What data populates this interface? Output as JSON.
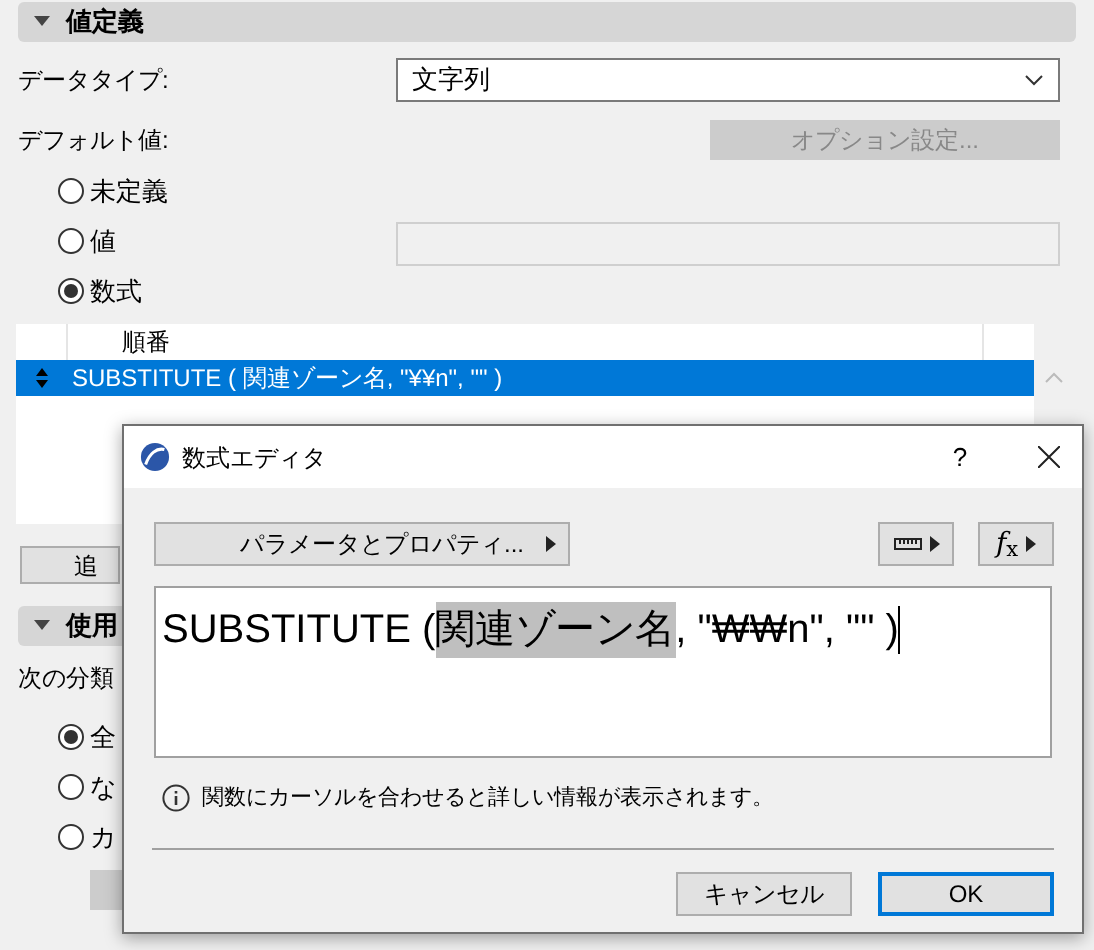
{
  "value_section": {
    "title": "値定義",
    "expanded": true
  },
  "data_type": {
    "label": "データタイプ:",
    "value": "文字列"
  },
  "default_value": {
    "label": "デフォルト値:",
    "options_button": {
      "label": "オプション設定...",
      "disabled": true
    }
  },
  "default_options": [
    {
      "label": "未定義",
      "selected": false
    },
    {
      "label": "値",
      "selected": false
    },
    {
      "label": "数式",
      "selected": true
    }
  ],
  "expression_list": {
    "header": "順番",
    "rows": [
      {
        "text": "SUBSTITUTE ( 関連ゾーン名, \"¥¥n\", \"\" )",
        "selected": true
      }
    ]
  },
  "add_button": "追",
  "availability_section": {
    "title": "使用",
    "expanded": true
  },
  "classification_label": "次の分類",
  "classification_options": [
    {
      "label": "全",
      "selected": true
    },
    {
      "label": "な",
      "selected": false
    },
    {
      "label": "カ",
      "selected": false
    }
  ],
  "dialog": {
    "title": "数式エディタ",
    "help": "?",
    "params_button": "パラメータとプロパティ...",
    "function_button": "*f*$_{x}$",
    "expression": {
      "before": "SUBSTITUTE ( ",
      "highlight": "関連ゾーン名",
      "after": ", \"₩₩n\", \"\" )"
    },
    "info": "関数にカーソルを合わせると詳しい情報が表示されます。",
    "buttons": [
      {
        "label": "キャンセル",
        "default": false
      },
      {
        "label": "OK",
        "default": true
      }
    ]
  }
}
